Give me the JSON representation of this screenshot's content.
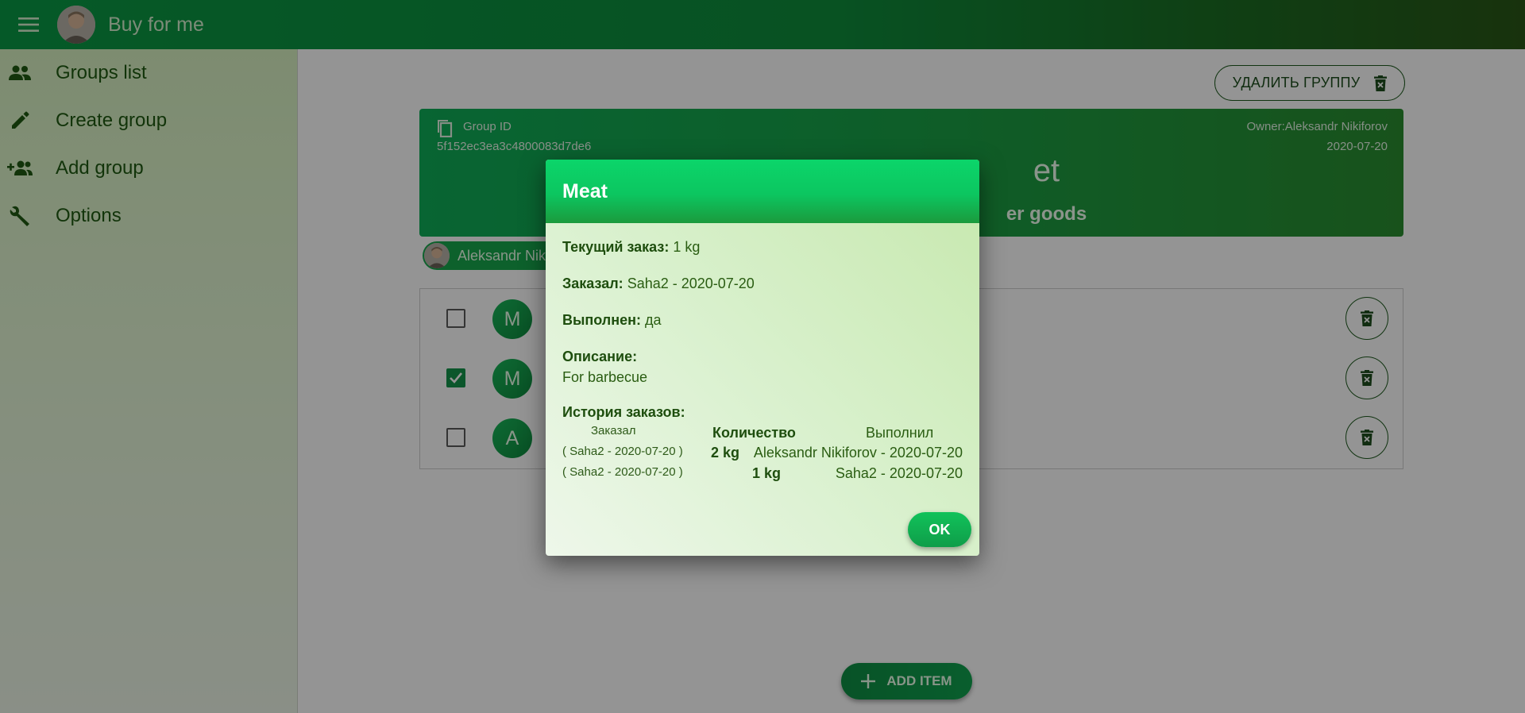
{
  "app": {
    "title": "Buy for me"
  },
  "sidebar": {
    "items": [
      {
        "label": "Groups list",
        "icon": "group-icon"
      },
      {
        "label": "Create group",
        "icon": "pencil-icon"
      },
      {
        "label": "Add group",
        "icon": "group-add-icon"
      },
      {
        "label": "Options",
        "icon": "wrench-icon"
      }
    ]
  },
  "group": {
    "delete_label": "УДАЛИТЬ ГРУППУ",
    "id_label": "Group ID",
    "id": "5f152ec3ea3c4800083d7de6",
    "owner": "Owner:Aleksandr Nikiforov",
    "date": "2020-07-20",
    "name_visible": "et",
    "description_visible": "er goods",
    "member_visible": "Aleksandr Niki"
  },
  "items": [
    {
      "letter": "M",
      "checked": false
    },
    {
      "letter": "M",
      "checked": true
    },
    {
      "letter": "A",
      "checked": false
    }
  ],
  "add_item_label": "ADD ITEM",
  "dialog": {
    "title": "Meat",
    "current_label": "Текущий заказ:",
    "current_value": "1 kg",
    "ordered_label": "Заказал:",
    "ordered_value": "Saha2 - 2020-07-20",
    "done_label": "Выполнен:",
    "done_value": "да",
    "desc_label": "Описание:",
    "desc_value": "For barbecue",
    "history_label": "История заказов:",
    "history_headers": {
      "ordered": "Заказал",
      "quantity": "Количество",
      "fulfilled": "Выполнил"
    },
    "history_rows": [
      {
        "ordered": "( Saha2 - 2020-07-20 )",
        "quantity": "2 kg",
        "fulfilled": "Aleksandr Nikiforov - 2020-07-20"
      },
      {
        "ordered": "( Saha2 - 2020-07-20 )",
        "quantity": "1 kg",
        "fulfilled": "Saha2 - 2020-07-20"
      }
    ],
    "ok_label": "OK"
  },
  "colors": {
    "primary": "#0fa048",
    "accent": "#0bd56a",
    "text": "#1d5a1d"
  }
}
